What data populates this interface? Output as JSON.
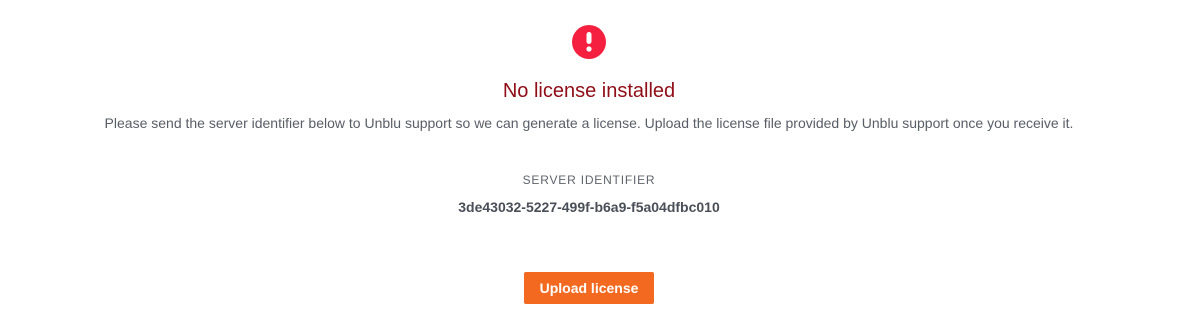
{
  "alert": {
    "icon": "exclamation-circle-icon",
    "color": "#f5203f"
  },
  "title": "No license installed",
  "message": "Please send the server identifier below to Unblu support so we can generate a license. Upload the license file provided by Unblu support once you receive it.",
  "server_identifier": {
    "label": "SERVER IDENTIFIER",
    "value": "3de43032-5227-499f-b6a9-f5a04dfbc010"
  },
  "upload_button": {
    "label": "Upload license",
    "color": "#f2691f"
  },
  "colors": {
    "title": "#8f0d17",
    "text": "#595d66"
  }
}
